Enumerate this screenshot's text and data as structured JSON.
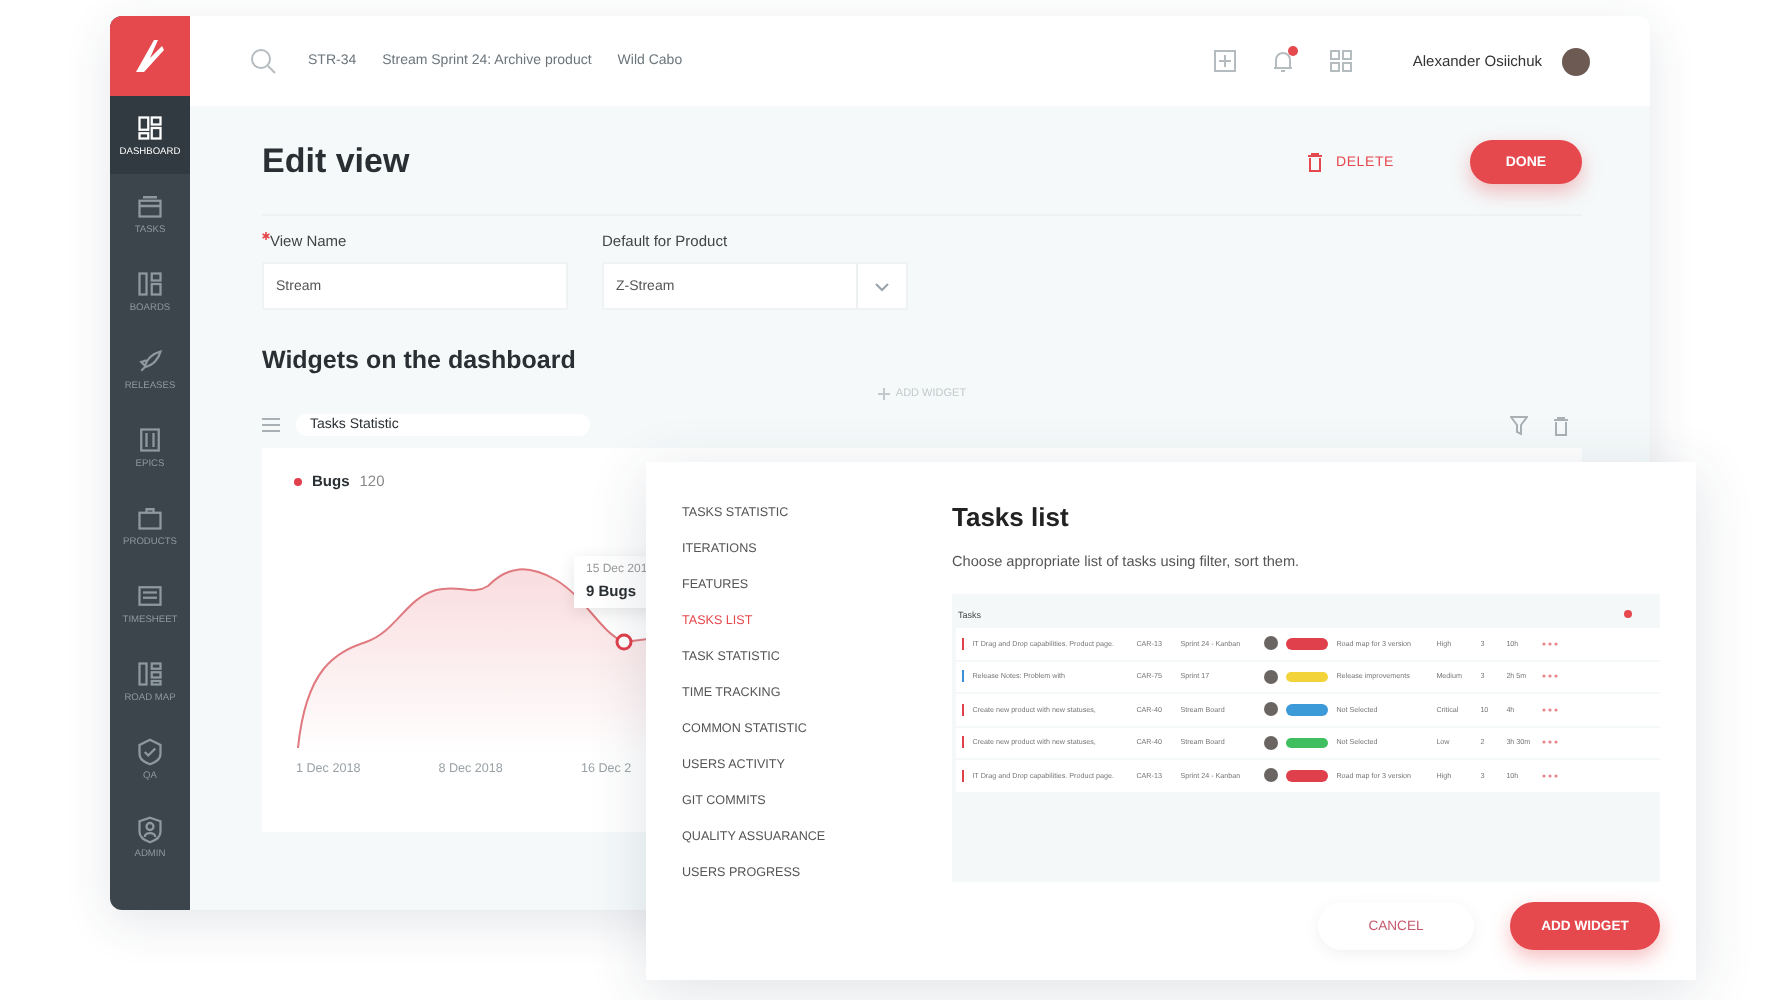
{
  "sidebar": {
    "items": [
      {
        "label": "DASHBOARD",
        "selected": true
      },
      {
        "label": "TASKS",
        "selected": false
      },
      {
        "label": "BOARDS",
        "selected": false
      },
      {
        "label": "RELEASES",
        "selected": false
      },
      {
        "label": "EPICS",
        "selected": false
      },
      {
        "label": "PRODUCTS",
        "selected": false
      },
      {
        "label": "TIMESHEET",
        "selected": false
      },
      {
        "label": "ROAD MAP",
        "selected": false
      },
      {
        "label": "QA",
        "selected": false
      },
      {
        "label": "ADMIN",
        "selected": false
      }
    ]
  },
  "topbar": {
    "breadcrumbs": [
      "STR-34",
      "Stream Sprint 24: Archive product",
      "Wild Cabo"
    ],
    "has_unread": true,
    "user": "Alexander Osiichuk"
  },
  "page": {
    "title": "Edit view",
    "delete": "DELETE",
    "done": "DONE",
    "fields": [
      {
        "label": "View Name",
        "required": true,
        "value": "Stream",
        "kind": "text"
      },
      {
        "label": "Default for Product",
        "required": false,
        "value": "Z-Stream",
        "kind": "select"
      }
    ],
    "section": "Widgets on the dashboard",
    "add_widget": "ADD WIDGET",
    "widget": {
      "name": "Tasks Statistic",
      "legend": "Bugs",
      "count": "120",
      "tooltip_date": "15 Dec 201",
      "tooltip_value": "9 Bugs",
      "x_labels": [
        "1 Dec 2018",
        "8 Dec 2018",
        "16 Dec 2"
      ]
    }
  },
  "modal": {
    "menu": [
      {
        "label": "TASKS STATISTIC",
        "selected": false
      },
      {
        "label": "ITERATIONS",
        "selected": false
      },
      {
        "label": "FEATURES",
        "selected": false
      },
      {
        "label": "TASKS LIST",
        "selected": true
      },
      {
        "label": "TASK STATISTIC",
        "selected": false
      },
      {
        "label": "TIME TRACKING",
        "selected": false
      },
      {
        "label": "COMMON STATISTIC",
        "selected": false
      },
      {
        "label": "USERS ACTIVITY",
        "selected": false
      },
      {
        "label": "GIT COMMITS",
        "selected": false
      },
      {
        "label": "QUALITY ASSUARANCE",
        "selected": false
      },
      {
        "label": "USERS PROGRESS",
        "selected": false
      }
    ],
    "title": "Tasks list",
    "description": "Choose appropriate list of tasks using filter, sort them.",
    "preview": {
      "title": "Tasks",
      "rows": [
        {
          "name": "IT Drag and Drop capabilities. Product page.",
          "id": "CAR-13",
          "sprint": "Sprint 24 - Kanban",
          "status": {
            "color": "#e0404c"
          },
          "epic": "Road map for 3 version",
          "priority": {
            "label": "High",
            "color": "#e0404c"
          },
          "count": "3",
          "time": "10h"
        },
        {
          "name": "Release Notes: Problem with",
          "id": "CAR-75",
          "sprint": "Sprint 17",
          "status": {
            "color": "#f2d43a"
          },
          "epic": "Release improvements",
          "priority": {
            "label": "Medium",
            "color": "#3d8fd6"
          },
          "count": "3",
          "time": "2h 5m"
        },
        {
          "name": "Create new product with new statuses,",
          "id": "CAR-40",
          "sprint": "Stream Board",
          "status": {
            "color": "#3d9ad9"
          },
          "epic": "Not Selected",
          "priority": {
            "label": "Critical",
            "color": "#e0404c"
          },
          "count": "10",
          "time": "4h"
        },
        {
          "name": "Create new product with new statuses,",
          "id": "CAR-40",
          "sprint": "Stream Board",
          "status": {
            "color": "#3fbf5f"
          },
          "epic": "Not Selected",
          "priority": {
            "label": "Low",
            "color": "#e0404c"
          },
          "count": "2",
          "time": "3h 30m"
        },
        {
          "name": "IT Drag and Drop capabilities. Product page.",
          "id": "CAR-13",
          "sprint": "Sprint 24 - Kanban",
          "status": {
            "color": "#e0404c"
          },
          "epic": "Road map for 3 version",
          "priority": {
            "label": "High",
            "color": "#e0404c"
          },
          "count": "3",
          "time": "10h"
        }
      ]
    },
    "cancel": "CANCEL",
    "confirm": "ADD WIDGET"
  }
}
